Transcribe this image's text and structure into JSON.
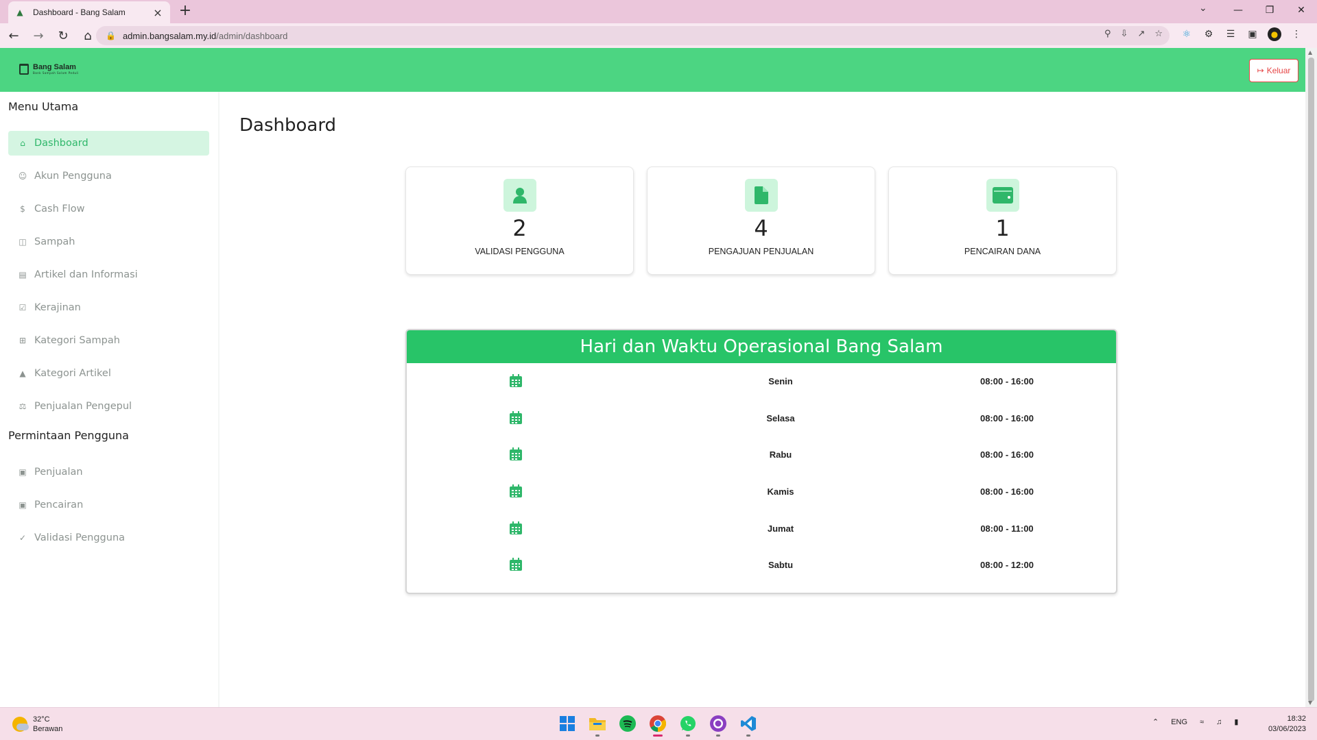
{
  "browser": {
    "tab_title": "Dashboard - Bang Salam",
    "url_host": "admin.bangsalam.my.id",
    "url_path": "/admin/dashboard"
  },
  "header": {
    "brand_name": "Bang Salam",
    "brand_tagline": "Bank Sampah Salam Peduli",
    "logout_label": "Keluar"
  },
  "sidebar": {
    "heading_main": "Menu Utama",
    "main_items": [
      {
        "label": "Dashboard",
        "icon": "home-icon",
        "active": true
      },
      {
        "label": "Akun Pengguna",
        "icon": "user-circle-icon"
      },
      {
        "label": "Cash Flow",
        "icon": "dollar-icon"
      },
      {
        "label": "Sampah",
        "icon": "trash-icon"
      },
      {
        "label": "Artikel dan Informasi",
        "icon": "article-icon"
      },
      {
        "label": "Kerajinan",
        "icon": "craft-icon"
      },
      {
        "label": "Kategori Sampah",
        "icon": "grid-icon"
      },
      {
        "label": "Kategori Artikel",
        "icon": "shapes-icon"
      },
      {
        "label": "Penjualan Pengepul",
        "icon": "scale-icon"
      }
    ],
    "heading_requests": "Permintaan Pengguna",
    "request_items": [
      {
        "label": "Penjualan",
        "icon": "card-icon"
      },
      {
        "label": "Pencairan",
        "icon": "card-icon"
      },
      {
        "label": "Validasi Pengguna",
        "icon": "check-icon"
      }
    ]
  },
  "main": {
    "page_title": "Dashboard",
    "stats": [
      {
        "value": "2",
        "label": "VALIDASI PENGGUNA",
        "icon": "user-icon"
      },
      {
        "value": "4",
        "label": "PENGAJUAN PENJUALAN",
        "icon": "file-icon"
      },
      {
        "value": "1",
        "label": "PENCAIRAN DANA",
        "icon": "wallet-icon"
      }
    ],
    "schedule": {
      "title": "Hari dan Waktu Operasional Bang Salam",
      "rows": [
        {
          "day": "Senin",
          "hours": "08:00 - 16:00"
        },
        {
          "day": "Selasa",
          "hours": "08:00 - 16:00"
        },
        {
          "day": "Rabu",
          "hours": "08:00 - 16:00"
        },
        {
          "day": "Kamis",
          "hours": "08:00 - 16:00"
        },
        {
          "day": "Jumat",
          "hours": "08:00 - 11:00"
        },
        {
          "day": "Sabtu",
          "hours": "08:00 - 12:00"
        }
      ]
    }
  },
  "taskbar": {
    "temperature": "32°C",
    "weather": "Berawan",
    "language": "ENG",
    "time": "18:32",
    "date": "03/06/2023"
  },
  "colors": {
    "header_green": "#4cd582",
    "schedule_green": "#28c468",
    "active_bg": "#d5f5e2",
    "logout_red": "#e64545"
  }
}
